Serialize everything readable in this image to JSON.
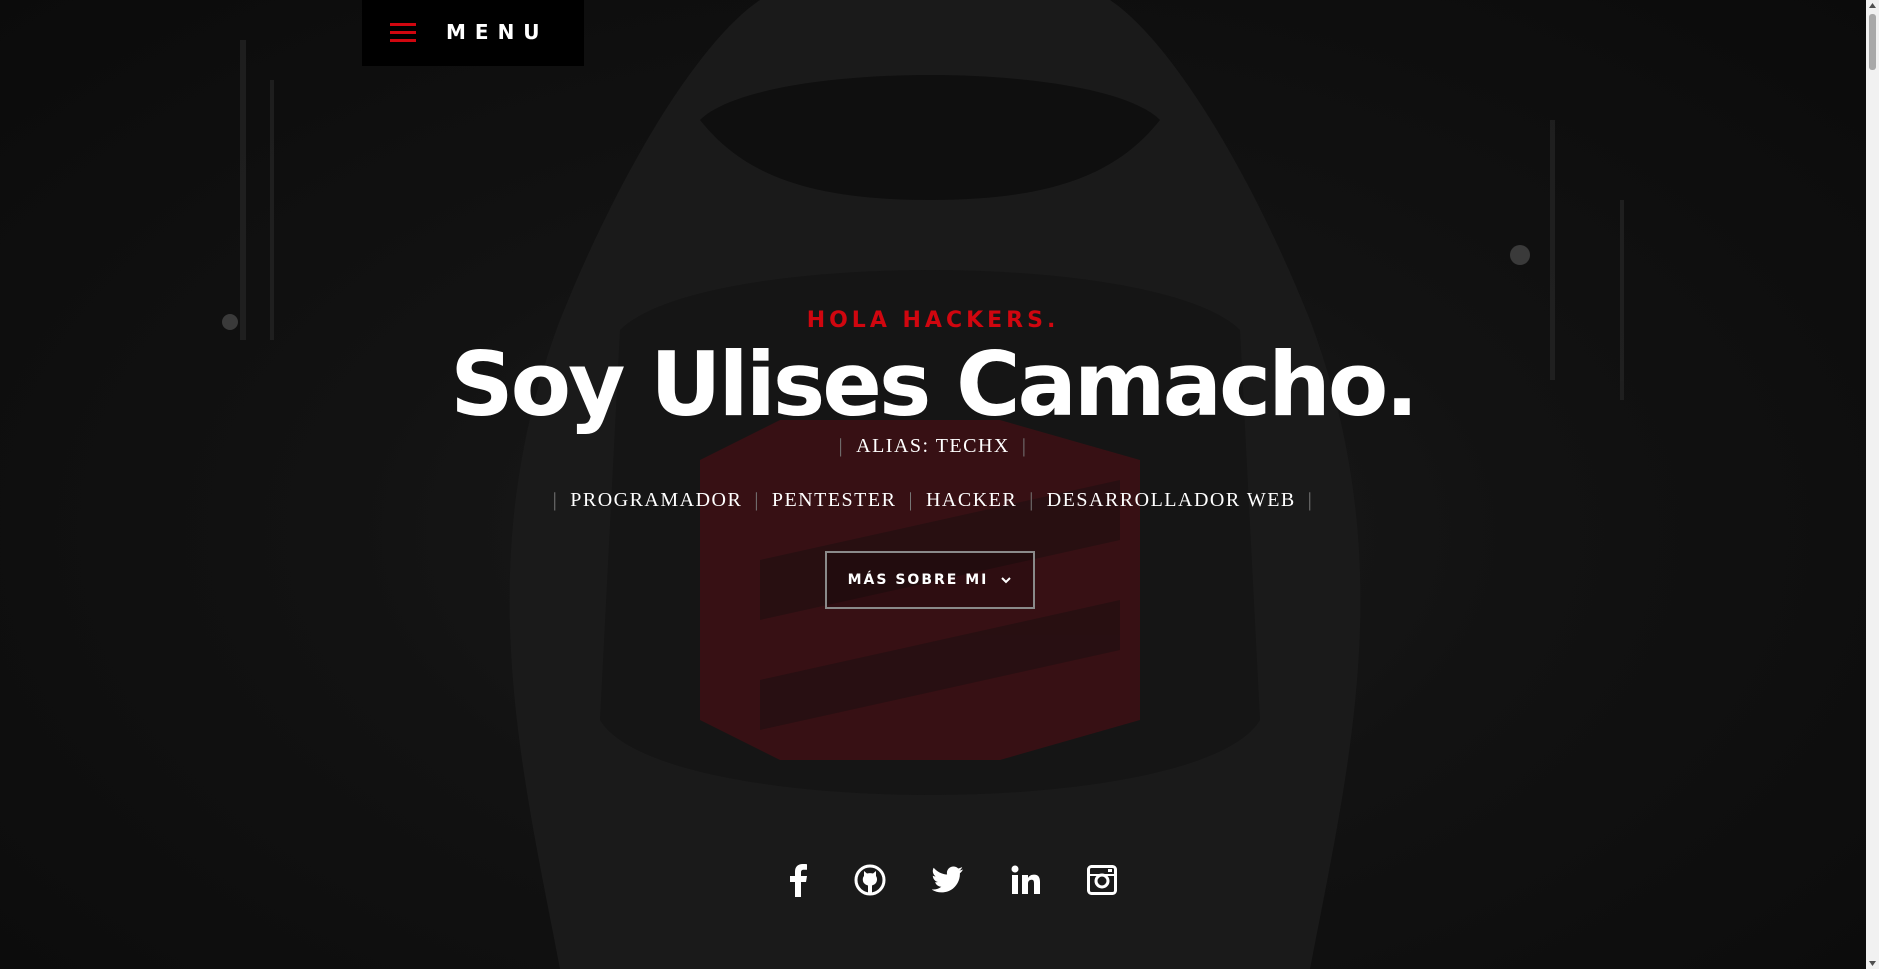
{
  "menu": {
    "label": "MENU",
    "icon": "hamburger-icon"
  },
  "hero": {
    "kicker": "HOLA HACKERS.",
    "title": "Soy Ulises Camacho.",
    "alias": "ALIAS: TECHX",
    "roles": [
      "PROGRAMADOR",
      "PENTESTER",
      "HACKER",
      "DESARROLLADOR WEB"
    ],
    "separator": "|",
    "cta_label": "MÁS SOBRE MI",
    "cta_icon": "chevron-down-icon"
  },
  "social": [
    {
      "name": "facebook",
      "icon": "facebook-icon"
    },
    {
      "name": "github",
      "icon": "github-icon"
    },
    {
      "name": "twitter",
      "icon": "twitter-icon"
    },
    {
      "name": "linkedin",
      "icon": "linkedin-icon"
    },
    {
      "name": "instagram",
      "icon": "instagram-icon"
    }
  ],
  "colors": {
    "accent": "#d0060f",
    "background": "#0e0e0e",
    "text": "#ffffff",
    "separator": "#777777"
  }
}
